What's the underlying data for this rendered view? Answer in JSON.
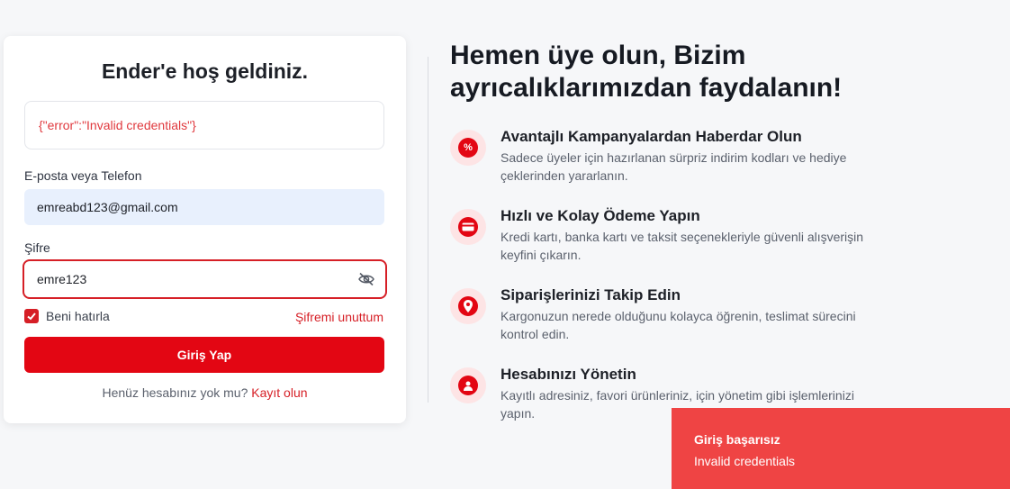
{
  "login": {
    "title": "Ender'e hoş geldiniz.",
    "error_message": "{\"error\":\"Invalid credentials\"}",
    "email_label": "E-posta veya Telefon",
    "email_value": "emreabd123@gmail.com",
    "password_label": "Şifre",
    "password_value": "emre123",
    "remember_label": "Beni hatırla",
    "remember_checked": true,
    "forgot_label": "Şifremi unuttum",
    "submit_label": "Giriş Yap",
    "signup_prompt": "Henüz hesabınız yok mu?",
    "signup_link": "Kayıt olun"
  },
  "hero": {
    "title": "Hemen üye olun, Bizim ayrıcalıklarımızdan faydalanın!",
    "features": [
      {
        "icon": "percent-icon",
        "title": "Avantajlı Kampanyalardan Haberdar Olun",
        "description": "Sadece üyeler için hazırlanan sürpriz indirim kodları ve hediye çeklerinden yararlanın."
      },
      {
        "icon": "credit-card-icon",
        "title": "Hızlı ve Kolay Ödeme Yapın",
        "description": "Kredi kartı, banka kartı ve taksit seçenekleriyle güvenli alışverişin keyfini çıkarın."
      },
      {
        "icon": "location-pin-icon",
        "title": "Siparişlerinizi Takip Edin",
        "description": "Kargonuzun nerede olduğunu kolayca öğrenin, teslimat sürecini kontrol edin."
      },
      {
        "icon": "user-icon",
        "title": "Hesabınızı Yönetin",
        "description": "Kayıtlı adresiniz, favori ürünleriniz, için yönetim gibi işlemlerinizi yapın."
      }
    ]
  },
  "toast": {
    "title": "Giriş başarısız",
    "message": "Invalid credentials"
  },
  "colors": {
    "brand_red": "#e30613",
    "error_text": "#e0393e",
    "toast_bg": "#ef4444",
    "email_input_bg": "#e8f0fd"
  }
}
